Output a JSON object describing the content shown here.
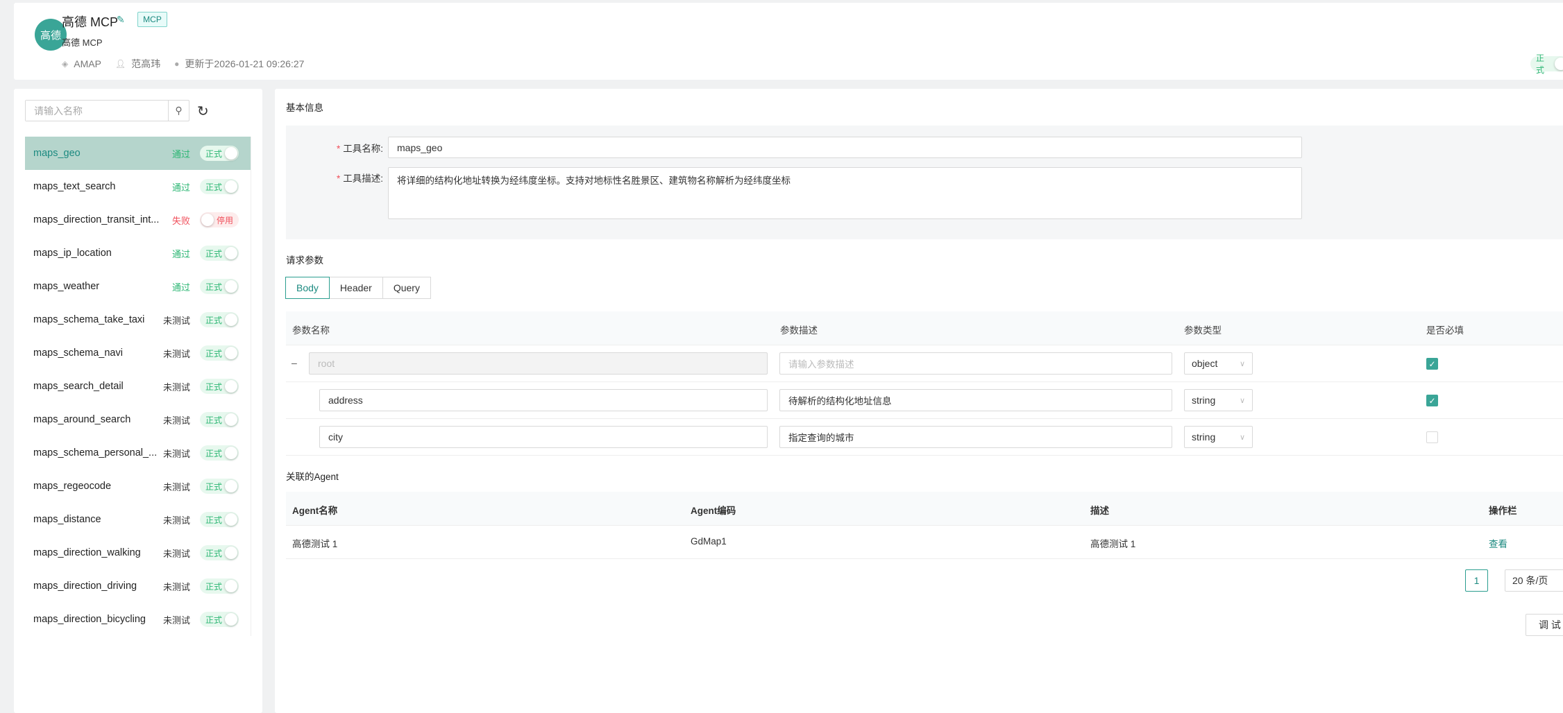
{
  "header": {
    "avatar_text": "高德",
    "title": "高德 MCP",
    "tag": "MCP",
    "subtitle": "高德 MCP",
    "meta": {
      "namespace": "AMAP",
      "owner": "范高玮",
      "updated": "更新于2026-01-21 09:26:27"
    },
    "status_toggle": "正式"
  },
  "sidebar": {
    "search_placeholder": "请输入名称",
    "items": [
      {
        "name": "maps_geo",
        "status": "通过",
        "status_type": "pass",
        "toggle": "正式",
        "on": true,
        "selected": true
      },
      {
        "name": "maps_text_search",
        "status": "通过",
        "status_type": "pass",
        "toggle": "正式",
        "on": true
      },
      {
        "name": "maps_direction_transit_int...",
        "status": "失败",
        "status_type": "fail",
        "toggle": "停用",
        "on": false
      },
      {
        "name": "maps_ip_location",
        "status": "通过",
        "status_type": "pass",
        "toggle": "正式",
        "on": true
      },
      {
        "name": "maps_weather",
        "status": "通过",
        "status_type": "pass",
        "toggle": "正式",
        "on": true
      },
      {
        "name": "maps_schema_take_taxi",
        "status": "未测试",
        "status_type": "none",
        "toggle": "正式",
        "on": true
      },
      {
        "name": "maps_schema_navi",
        "status": "未测试",
        "status_type": "none",
        "toggle": "正式",
        "on": true
      },
      {
        "name": "maps_search_detail",
        "status": "未测试",
        "status_type": "none",
        "toggle": "正式",
        "on": true
      },
      {
        "name": "maps_around_search",
        "status": "未测试",
        "status_type": "none",
        "toggle": "正式",
        "on": true
      },
      {
        "name": "maps_schema_personal_...",
        "status": "未测试",
        "status_type": "none",
        "toggle": "正式",
        "on": true
      },
      {
        "name": "maps_regeocode",
        "status": "未测试",
        "status_type": "none",
        "toggle": "正式",
        "on": true
      },
      {
        "name": "maps_distance",
        "status": "未测试",
        "status_type": "none",
        "toggle": "正式",
        "on": true
      },
      {
        "name": "maps_direction_walking",
        "status": "未测试",
        "status_type": "none",
        "toggle": "正式",
        "on": true
      },
      {
        "name": "maps_direction_driving",
        "status": "未测试",
        "status_type": "none",
        "toggle": "正式",
        "on": true
      },
      {
        "name": "maps_direction_bicycling",
        "status": "未测试",
        "status_type": "none",
        "toggle": "正式",
        "on": true
      }
    ]
  },
  "basic": {
    "title": "基本信息",
    "name_label": "工具名称:",
    "name_value": "maps_geo",
    "desc_label": "工具描述:",
    "desc_value": "将详细的结构化地址转换为经纬度坐标。支持对地标性名胜景区、建筑物名称解析为经纬度坐标"
  },
  "params": {
    "title": "请求参数",
    "tabs": [
      "Body",
      "Header",
      "Query"
    ],
    "active_tab": "Body",
    "columns": [
      "参数名称",
      "参数描述",
      "参数类型",
      "是否必填"
    ],
    "desc_placeholder": "请输入参数描述",
    "rows": [
      {
        "name": "root",
        "desc": "",
        "type": "object",
        "required": true
      },
      {
        "name": "address",
        "desc": "待解析的结构化地址信息",
        "type": "string",
        "required": true
      },
      {
        "name": "city",
        "desc": "指定查询的城市",
        "type": "string",
        "required": false
      }
    ]
  },
  "agents": {
    "title": "关联的Agent",
    "columns": [
      "Agent名称",
      "Agent编码",
      "描述",
      "操作栏"
    ],
    "rows": [
      {
        "name": "高德测试 1",
        "code": "GdMap1",
        "desc": "高德测试 1",
        "action": "查看"
      }
    ],
    "page": "1",
    "page_size": "20 条/页"
  },
  "debug_button": "调 试",
  "colors": {
    "accent": "#2a9d8f",
    "pass": "#2bb673",
    "fail": "#f0505c",
    "selected_row": "#b5d5cc"
  }
}
